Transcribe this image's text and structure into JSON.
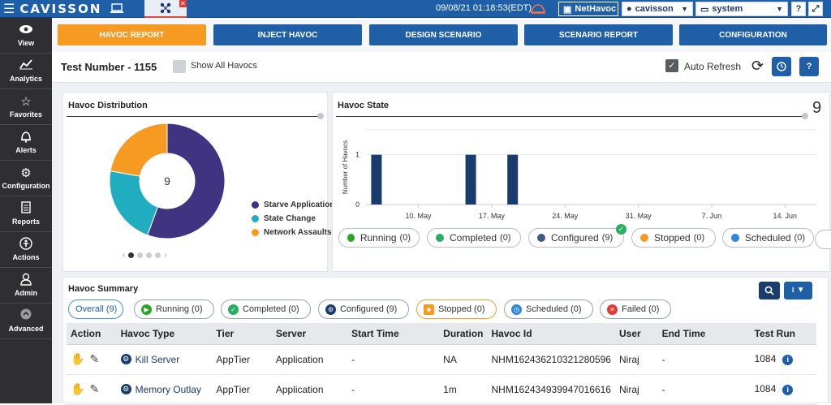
{
  "topbar": {
    "logo_text": "CAVISSON",
    "datetime": "09/08/21 01:18:53(EDT)",
    "nethavoc_label": "NetHavoc",
    "user_label": "cavisson",
    "system_label": "system",
    "help_label": "?"
  },
  "sidebar": {
    "items": [
      {
        "label": "View",
        "icon": "eye-icon"
      },
      {
        "label": "Analytics",
        "icon": "chart-icon"
      },
      {
        "label": "Favorites",
        "icon": "star-icon"
      },
      {
        "label": "Alerts",
        "icon": "bell-icon"
      },
      {
        "label": "Configuration",
        "icon": "gears-icon"
      },
      {
        "label": "Reports",
        "icon": "document-icon"
      },
      {
        "label": "Actions",
        "icon": "actions-icon"
      },
      {
        "label": "Admin",
        "icon": "admin-icon"
      },
      {
        "label": "Advanced",
        "icon": "advanced-icon"
      }
    ]
  },
  "tabs": [
    {
      "label": "HAVOC REPORT",
      "active": true
    },
    {
      "label": "INJECT HAVOC",
      "active": false
    },
    {
      "label": "DESIGN SCENARIO",
      "active": false
    },
    {
      "label": "SCENARIO REPORT",
      "active": false
    },
    {
      "label": "CONFIGURATION",
      "active": false
    }
  ],
  "header": {
    "test_number": "Test Number - 1155",
    "show_all_label": "Show All Havocs",
    "auto_refresh_label": "Auto Refresh",
    "auto_refresh_checked": true,
    "help_label": "?"
  },
  "distribution": {
    "title": "Havoc Distribution",
    "total": "9",
    "legend": [
      {
        "label": "Starve Application",
        "color": "#3f3382"
      },
      {
        "label": "State Change",
        "color": "#20adc0"
      },
      {
        "label": "Network Assaults",
        "color": "#f79a22"
      }
    ]
  },
  "state": {
    "title": "Havoc State",
    "total": "9",
    "chips": [
      {
        "label": "Running",
        "count": "(0)",
        "color": "#2aa52a",
        "checked": false
      },
      {
        "label": "Completed",
        "count": "(0)",
        "color": "#27ae60",
        "checked": false
      },
      {
        "label": "Configured",
        "count": "(9)",
        "color": "#3f5a7a",
        "checked": true
      },
      {
        "label": "Stopped",
        "count": "(0)",
        "color": "#f79a22",
        "checked": false
      },
      {
        "label": "Scheduled",
        "count": "(0)",
        "color": "#2e86de",
        "checked": false
      }
    ]
  },
  "chart_data": [
    {
      "type": "pie",
      "title": "Havoc Distribution",
      "labels": [
        "Starve Application",
        "State Change",
        "Network Assaults"
      ],
      "values": [
        5,
        2,
        2
      ],
      "colors": [
        "#3f3382",
        "#20adc0",
        "#f79a22"
      ],
      "center_text": "9",
      "donut": true
    },
    {
      "type": "bar",
      "title": "Havoc State",
      "ylabel": "Number of Havocs",
      "xlabel": "",
      "x_ticks": [
        "10. May",
        "17. May",
        "24. May",
        "31. May",
        "7. Jun",
        "14. Jun"
      ],
      "x_tick_dates": [
        "2021-05-10",
        "2021-05-17",
        "2021-05-24",
        "2021-05-31",
        "2021-06-07",
        "2021-06-14"
      ],
      "y_ticks": [
        "0",
        "1"
      ],
      "ylim": [
        0,
        1.5
      ],
      "xlim": [
        "2021-05-05",
        "2021-06-17"
      ],
      "bars": [
        {
          "x": "2021-05-06",
          "y": 1
        },
        {
          "x": "2021-05-15",
          "y": 1
        },
        {
          "x": "2021-05-19",
          "y": 1
        }
      ],
      "color": "#1a3b6e",
      "grid": true
    }
  ],
  "summary": {
    "title": "Havoc Summary",
    "filters": [
      {
        "label": "Overall (9)",
        "color": "",
        "icon": "",
        "kind": "active"
      },
      {
        "label": "Running (0)",
        "color": "#2aa52a",
        "icon": "running-icon",
        "kind": ""
      },
      {
        "label": "Completed (0)",
        "color": "#27ae60",
        "icon": "completed-icon",
        "kind": ""
      },
      {
        "label": "Configured (9)",
        "color": "#1a3b6e",
        "icon": "configured-icon",
        "kind": ""
      },
      {
        "label": "Stopped (0)",
        "color": "#f79a22",
        "icon": "stopped-icon",
        "kind": "stopped"
      },
      {
        "label": "Scheduled (0)",
        "color": "#2e86de",
        "icon": "scheduled-icon",
        "kind": ""
      },
      {
        "label": "Failed (0)",
        "color": "#e53935",
        "icon": "failed-icon",
        "kind": ""
      }
    ],
    "columns": [
      "Action",
      "Havoc Type",
      "Tier",
      "Server",
      "Start Time",
      "Duration",
      "Havoc Id",
      "User",
      "End Time",
      "Test Run"
    ],
    "rows": [
      {
        "type": "Kill Server",
        "tier": "AppTier",
        "server": "Application",
        "start": "-",
        "duration": "NA",
        "id": "NHM162436210321280596",
        "user": "Niraj",
        "end": "-",
        "run": "1084"
      },
      {
        "type": "Memory Outlay",
        "tier": "AppTier",
        "server": "Application",
        "start": "-",
        "duration": "1m",
        "id": "NHM162434939947016616",
        "user": "Niraj",
        "end": "-",
        "run": "1084"
      }
    ]
  }
}
